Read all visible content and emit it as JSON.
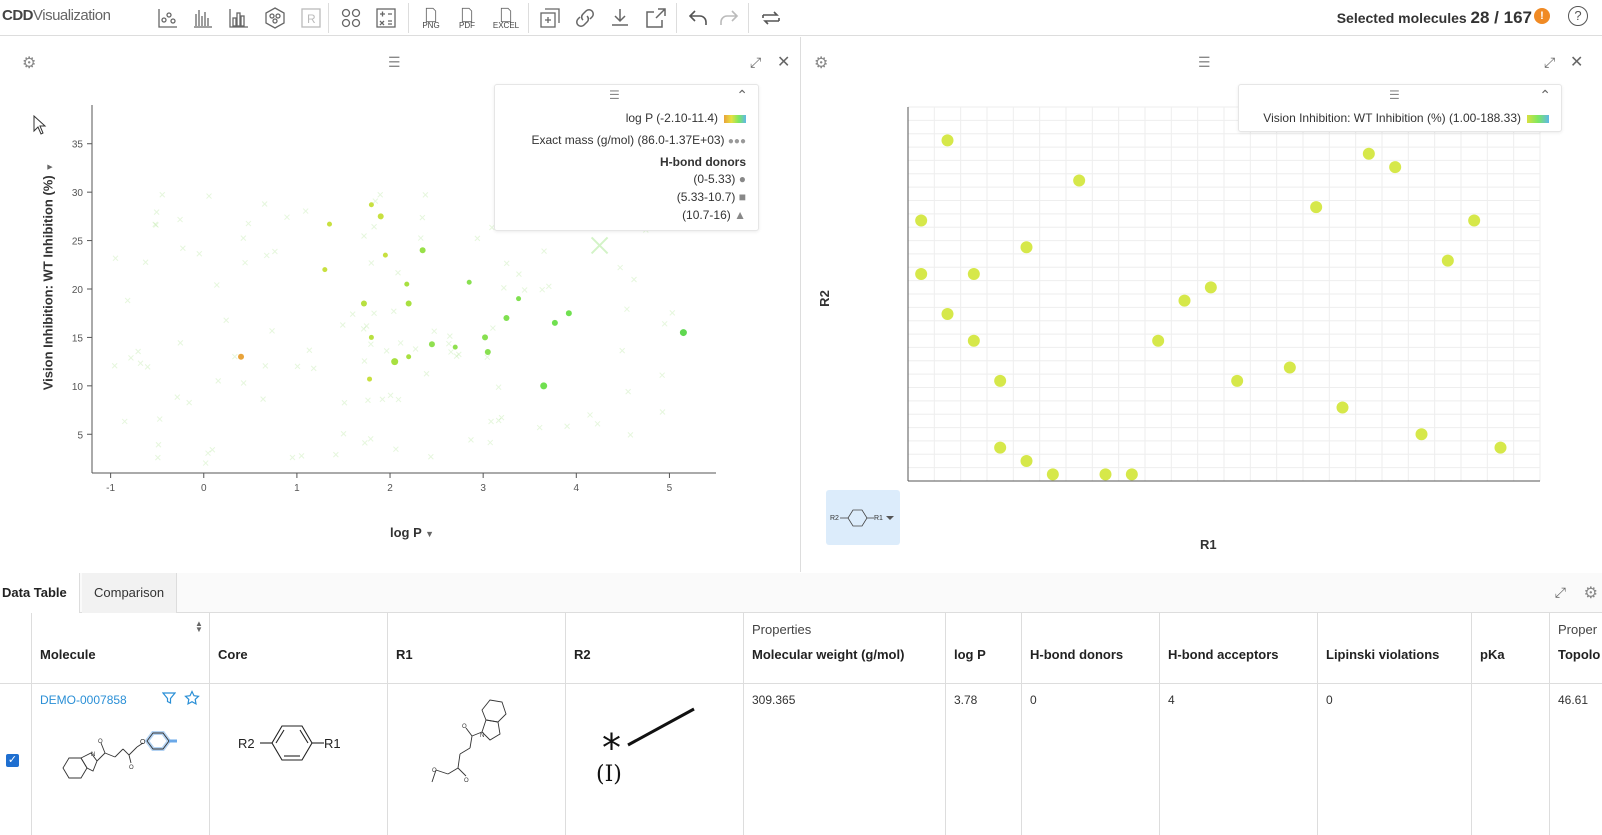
{
  "app": {
    "logo_cdd": "CDD",
    "logo_viz": "Visualization"
  },
  "toolbar": {
    "png_label": "PNG",
    "pdf_label": "PDF",
    "excel_label": "EXCEL",
    "selected_label": "Selected molecules",
    "selected_count": "28 / 167",
    "warn": "!",
    "help": "?"
  },
  "scatter": {
    "legend": {
      "color_by": "log P (-2.10-11.4)",
      "size_by": "Exact mass (g/mol) (86.0-1.37E+03)",
      "shape_title": "H-bond donors",
      "shapes": [
        "(0-5.33)",
        "(5.33-10.7)",
        "(10.7-16)"
      ]
    },
    "chart_data": {
      "type": "scatter",
      "xlabel": "log P",
      "ylabel": "Vision Inhibition: WT Inhibition (%)",
      "xlim": [
        -1.2,
        5.5
      ],
      "ylim": [
        1,
        39
      ],
      "xticks": [
        "-1",
        "0",
        "1",
        "2",
        "3",
        "4",
        "5"
      ],
      "yticks": [
        "5",
        "10",
        "15",
        "20",
        "25",
        "30",
        "35"
      ],
      "points": [
        {
          "x": 0.4,
          "y": 13.0,
          "c": "#e8a33a",
          "r": 3
        },
        {
          "x": 1.3,
          "y": 22.0,
          "c": "#c8e040",
          "r": 2.5
        },
        {
          "x": 1.35,
          "y": 26.7,
          "c": "#c8e040",
          "r": 2.5
        },
        {
          "x": 1.8,
          "y": 28.7,
          "c": "#c8e040",
          "r": 2.5
        },
        {
          "x": 1.9,
          "y": 27.5,
          "c": "#c8e040",
          "r": 3
        },
        {
          "x": 1.95,
          "y": 23.5,
          "c": "#c8e040",
          "r": 2.5
        },
        {
          "x": 1.72,
          "y": 18.5,
          "c": "#b8e040",
          "r": 3
        },
        {
          "x": 1.8,
          "y": 15.0,
          "c": "#b8e040",
          "r": 2.5
        },
        {
          "x": 1.78,
          "y": 10.7,
          "c": "#c8e040",
          "r": 2.5
        },
        {
          "x": 2.05,
          "y": 12.5,
          "c": "#a8e040",
          "r": 3.5
        },
        {
          "x": 2.2,
          "y": 13.0,
          "c": "#a8e040",
          "r": 2.5
        },
        {
          "x": 2.2,
          "y": 18.5,
          "c": "#a8e040",
          "r": 3
        },
        {
          "x": 2.18,
          "y": 20.5,
          "c": "#a8e040",
          "r": 2.5
        },
        {
          "x": 2.35,
          "y": 24.0,
          "c": "#98e048",
          "r": 3
        },
        {
          "x": 2.45,
          "y": 14.3,
          "c": "#90e050",
          "r": 3
        },
        {
          "x": 2.7,
          "y": 14.0,
          "c": "#90e050",
          "r": 2.5
        },
        {
          "x": 2.85,
          "y": 20.7,
          "c": "#88e050",
          "r": 2.5
        },
        {
          "x": 3.02,
          "y": 15.0,
          "c": "#88e050",
          "r": 3
        },
        {
          "x": 3.05,
          "y": 13.5,
          "c": "#88e050",
          "r": 3
        },
        {
          "x": 3.25,
          "y": 17.0,
          "c": "#80e050",
          "r": 3
        },
        {
          "x": 3.38,
          "y": 19.0,
          "c": "#80e050",
          "r": 2.5
        },
        {
          "x": 3.65,
          "y": 10.0,
          "c": "#70e050",
          "r": 3.5
        },
        {
          "x": 3.77,
          "y": 16.5,
          "c": "#70e050",
          "r": 3
        },
        {
          "x": 3.92,
          "y": 17.5,
          "c": "#70e050",
          "r": 3
        },
        {
          "x": 5.15,
          "y": 15.5,
          "c": "#60d850",
          "r": 3.5
        }
      ]
    }
  },
  "rgroup": {
    "legend": {
      "color_by": "Vision Inhibition: WT Inhibition (%) (1.00-188.33)"
    },
    "chart_data": {
      "type": "scatter",
      "xlabel": "R1",
      "ylabel": "R2",
      "points": [
        {
          "x": 2,
          "y": 26
        },
        {
          "x": 1,
          "y": 20
        },
        {
          "x": 1,
          "y": 16
        },
        {
          "x": 2,
          "y": 13
        },
        {
          "x": 3,
          "y": 16
        },
        {
          "x": 3,
          "y": 11
        },
        {
          "x": 4,
          "y": 8
        },
        {
          "x": 4,
          "y": 3
        },
        {
          "x": 5,
          "y": 18
        },
        {
          "x": 5,
          "y": 2
        },
        {
          "x": 6,
          "y": 1
        },
        {
          "x": 7,
          "y": 23
        },
        {
          "x": 8,
          "y": 1
        },
        {
          "x": 9,
          "y": 1
        },
        {
          "x": 10,
          "y": 11
        },
        {
          "x": 11,
          "y": 14
        },
        {
          "x": 12,
          "y": 15
        },
        {
          "x": 13,
          "y": 8
        },
        {
          "x": 15,
          "y": 9
        },
        {
          "x": 16,
          "y": 21
        },
        {
          "x": 17,
          "y": 6
        },
        {
          "x": 18,
          "y": 25
        },
        {
          "x": 19,
          "y": 24
        },
        {
          "x": 20,
          "y": 4
        },
        {
          "x": 21,
          "y": 17
        },
        {
          "x": 22,
          "y": 20
        },
        {
          "x": 23,
          "y": 3
        }
      ]
    },
    "core_label_r2": "R2",
    "core_label_r1": "R1"
  },
  "tabs": {
    "data_table": "Data Table",
    "comparison": "Comparison"
  },
  "table": {
    "group_properties": "Properties",
    "group_properties2": "Proper",
    "headers": {
      "molecule": "Molecule",
      "core": "Core",
      "r1": "R1",
      "r2": "R2",
      "mw": "Molecular weight (g/mol)",
      "logp": "log P",
      "hbd": "H-bond donors",
      "hba": "H-bond acceptors",
      "lipinski": "Lipinski violations",
      "pka": "pKa",
      "topo": "Topolo"
    },
    "row": {
      "id": "DEMO-0007858",
      "mw": "309.365",
      "logp": "3.78",
      "hbd": "0",
      "hba": "4",
      "lipinski": "0",
      "pka": "",
      "topo": "46.61",
      "core_r2": "R2",
      "core_r1": "R1",
      "r2_label": "(I)"
    }
  }
}
